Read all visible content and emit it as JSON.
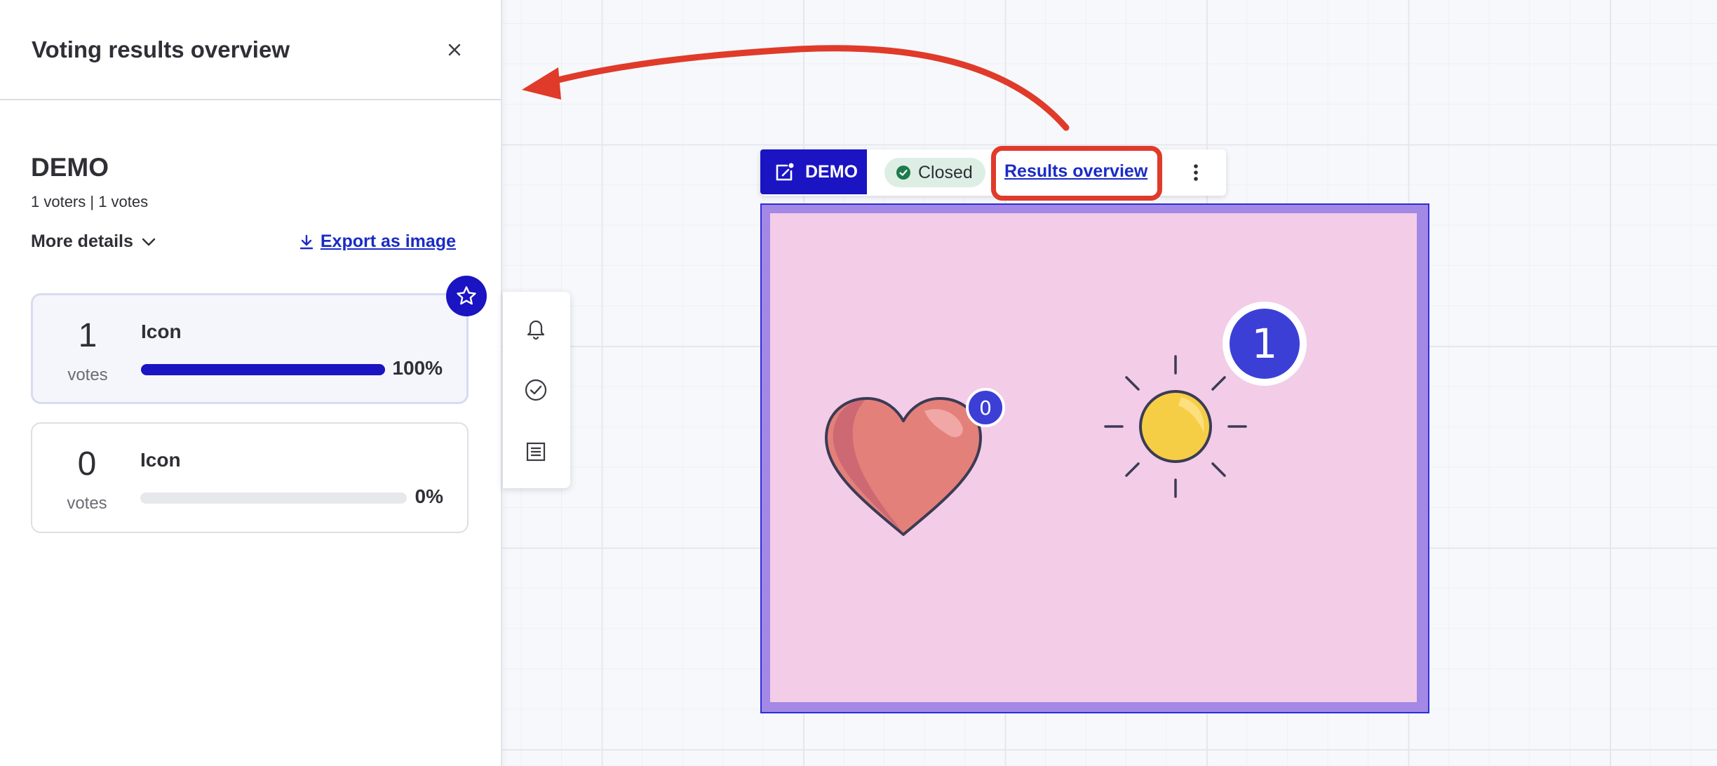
{
  "panel": {
    "title": "Voting results overview",
    "close_icon": "close-icon",
    "board_name": "DEMO",
    "stats": "1 voters | 1 votes",
    "more_details": "More details",
    "export_label": "Export as image",
    "results": [
      {
        "count": "1",
        "votes_label": "votes",
        "label": "Icon",
        "percent_text": "100%",
        "fill": 1.0,
        "winner": true
      },
      {
        "count": "0",
        "votes_label": "votes",
        "label": "Icon",
        "percent_text": "0%",
        "fill": 0.0,
        "winner": false
      }
    ]
  },
  "side_toolbar": {
    "icons": [
      "bell-icon",
      "check-circle-icon",
      "notes-icon"
    ]
  },
  "frame_toolbar": {
    "tag": "DEMO",
    "status": "Closed",
    "results_link": "Results overview"
  },
  "frame": {
    "heart_votes": "0",
    "sun_votes": "1"
  },
  "colors": {
    "brand": "#1a14c2",
    "link": "#1a2bc7",
    "annotation": "#e03a2a",
    "frame_bg": "#f3cce8",
    "frame_border": "#a488e6"
  }
}
